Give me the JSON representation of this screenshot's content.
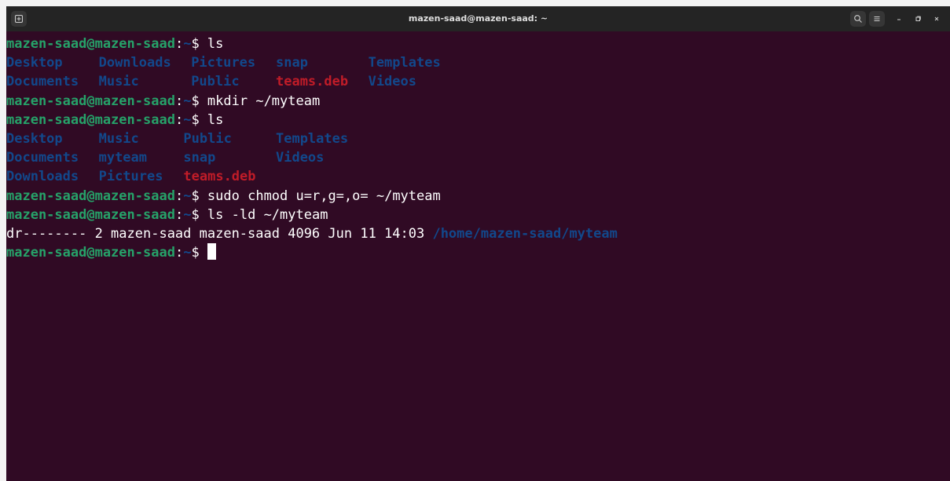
{
  "window": {
    "title": "mazen-saad@mazen-saad: ~"
  },
  "prompt": {
    "user_host": "mazen-saad@mazen-saad",
    "colon": ":",
    "path": "~",
    "symbol": "$ "
  },
  "commands": {
    "c1": "ls",
    "c2": "mkdir ~/myteam",
    "c3": "ls",
    "c4": "sudo chmod u=r,g=,o= ~/myteam",
    "c5": "ls -ld ~/myteam"
  },
  "ls1": {
    "rows": [
      [
        "Desktop",
        "Downloads",
        "Pictures",
        "snap",
        "Templates"
      ],
      [
        "Documents",
        "Music",
        "Public",
        "teams.deb",
        "Videos"
      ]
    ]
  },
  "ls2": {
    "rows": [
      [
        "Desktop",
        "Music",
        "Public",
        "Templates"
      ],
      [
        "Documents",
        "myteam",
        "snap",
        "Videos"
      ],
      [
        "Downloads",
        "Pictures",
        "teams.deb"
      ]
    ]
  },
  "ld_output": {
    "details": "dr-------- 2 mazen-saad mazen-saad 4096 Jun 11 14:03 ",
    "path": "/home/mazen-saad/myteam"
  },
  "colors": {
    "background": "#300a24",
    "prompt_user": "#26a269",
    "directory": "#12488b",
    "archive_file": "#c01c28",
    "titlebar": "#242424"
  },
  "icons": {
    "new_tab": "new-tab-icon",
    "search": "search-icon",
    "menu": "hamburger-menu-icon",
    "minimize": "minimize-icon",
    "maximize": "maximize-icon",
    "close": "close-icon"
  }
}
